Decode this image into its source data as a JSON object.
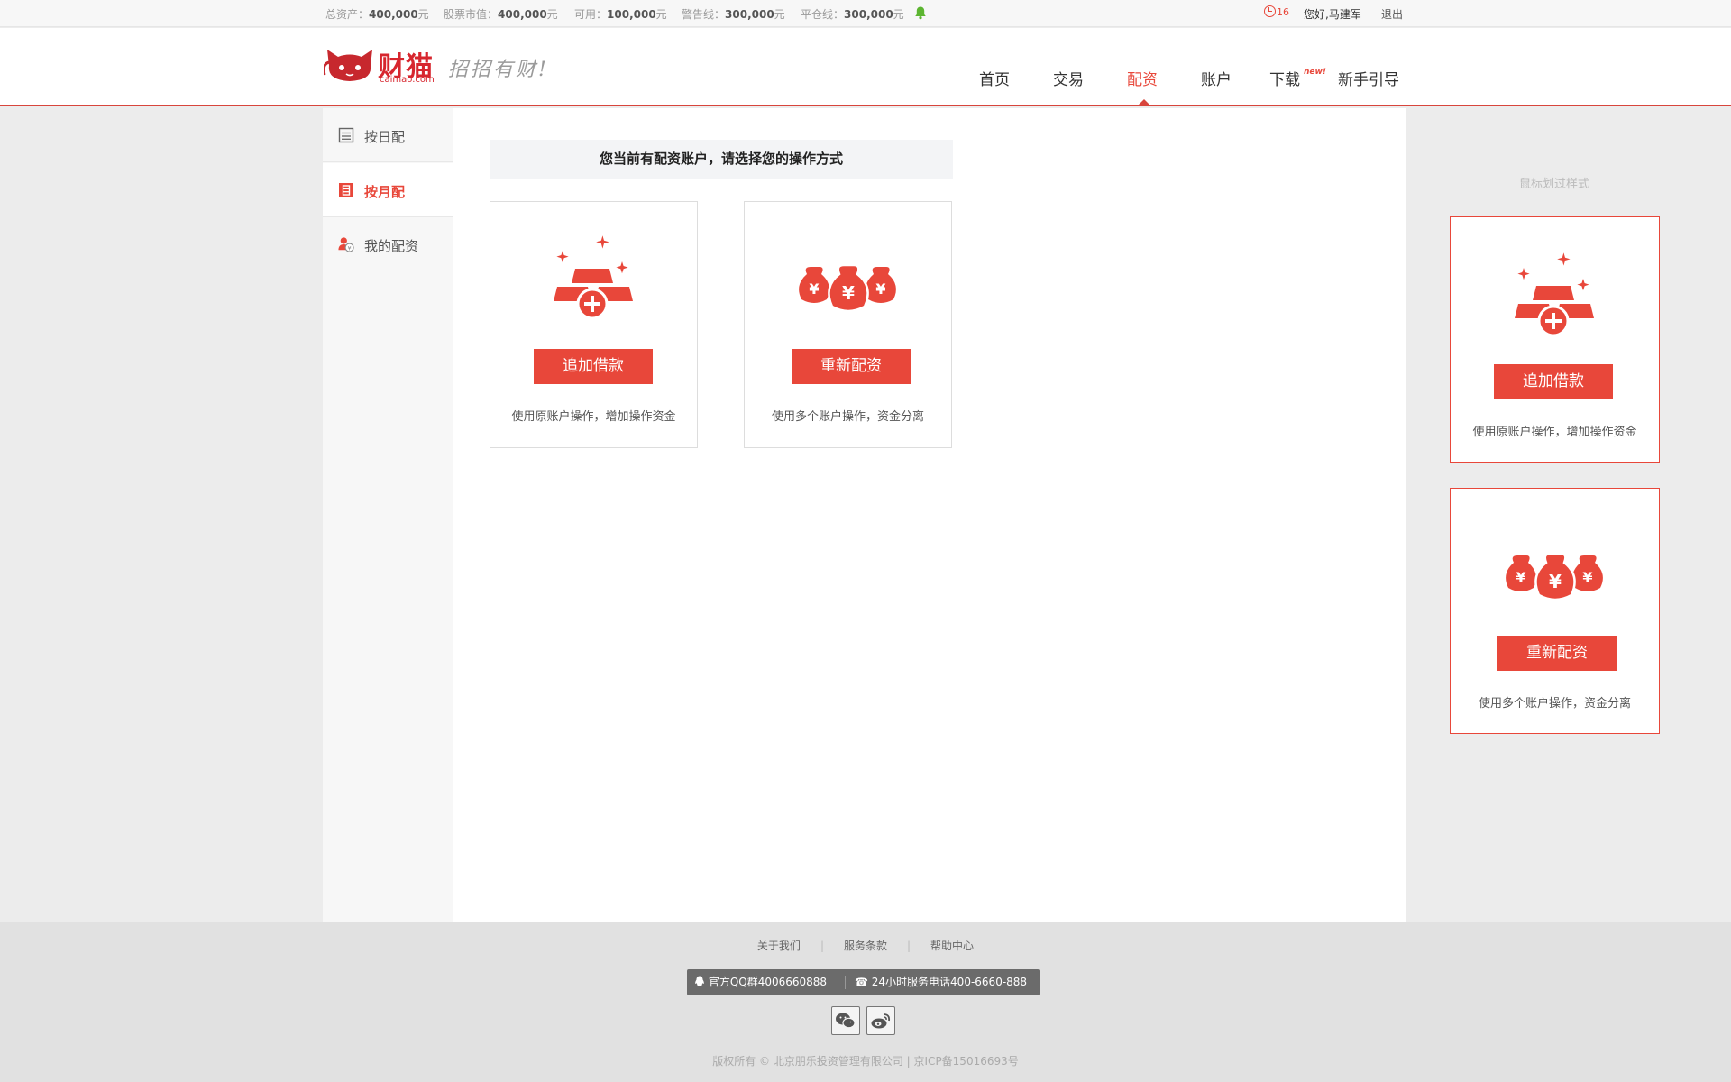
{
  "topbar": {
    "stats": [
      {
        "label": "总资产：",
        "value": "400,000",
        "unit": "元"
      },
      {
        "label": "股票市值：",
        "value": "400,000",
        "unit": "元"
      },
      {
        "label": "可用：",
        "value": "100,000",
        "unit": "元"
      },
      {
        "label": "警告线：",
        "value": "300,000",
        "unit": "元"
      },
      {
        "label": "平仓线：",
        "value": "300,000",
        "unit": "元"
      }
    ],
    "message_count": "16",
    "greeting": "您好,马建军",
    "logout": "退出"
  },
  "header": {
    "brand": "财猫",
    "brand_url": "caimao.com",
    "slogan": "招招有财!",
    "nav": [
      "首页",
      "交易",
      "配资",
      "账户",
      "下载",
      "新手引导"
    ],
    "nav_badge": "new!",
    "active_nav": "配资"
  },
  "sidebar": {
    "items": [
      {
        "label": "按日配",
        "icon": "calendar-day-icon",
        "active": false
      },
      {
        "label": "按月配",
        "icon": "calendar-month-icon",
        "active": true
      },
      {
        "label": "我的配资",
        "icon": "user-money-icon",
        "active": false
      }
    ]
  },
  "main": {
    "prompt": "您当前有配资账户，请选择您的操作方式",
    "options": [
      {
        "icon": "gold-bars-plus-icon",
        "button": "追加借款",
        "desc": "使用原账户操作，增加操作资金"
      },
      {
        "icon": "money-bags-icon",
        "button": "重新配资",
        "desc": "使用多个账户操作，资金分离"
      }
    ]
  },
  "hover_demo": {
    "title": "鼠标划过样式",
    "options": [
      {
        "button": "追加借款",
        "desc": "使用原账户操作，增加操作资金"
      },
      {
        "button": "重新配资",
        "desc": "使用多个账户操作，资金分离"
      }
    ]
  },
  "footer": {
    "links": [
      "关于我们",
      "服务条款",
      "帮助中心"
    ],
    "qq": "官方QQ群4006660888",
    "phone": "24小时服务电话400-6660-888",
    "copyright": "版权所有 © 北京朋乐投资管理有限公司  |  京ICP备15016693号"
  },
  "colors": {
    "accent": "#e8473a",
    "brand": "#d7262e"
  }
}
